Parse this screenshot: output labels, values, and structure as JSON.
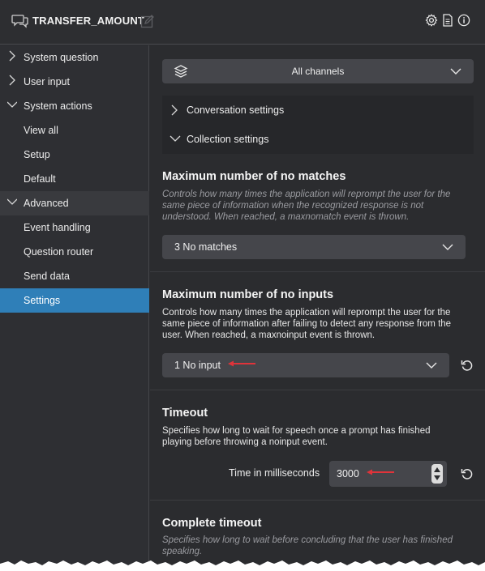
{
  "header": {
    "title": "TRANSFER_AMOUNT",
    "icons": [
      "chat-icon",
      "edit-icon",
      "gear-icon",
      "document-icon",
      "info-icon"
    ]
  },
  "sidebar": {
    "items": [
      {
        "label": "System question",
        "chevron": "right"
      },
      {
        "label": "User input",
        "chevron": "right"
      },
      {
        "label": "System actions",
        "chevron": "down"
      },
      {
        "label": "View all"
      },
      {
        "label": "Setup"
      },
      {
        "label": "Default"
      },
      {
        "label": "Advanced",
        "chevron": "down"
      },
      {
        "label": "Event handling"
      },
      {
        "label": "Question router"
      },
      {
        "label": "Send data"
      },
      {
        "label": "Settings",
        "active": true
      }
    ]
  },
  "main": {
    "channels_select": "All channels",
    "panels": [
      {
        "label": "Conversation settings",
        "chevron": "right"
      },
      {
        "label": "Collection settings",
        "chevron": "down"
      }
    ],
    "no_matches": {
      "title": "Maximum number of no matches",
      "description": "Controls how many times the application will reprompt the user for the same piece of information when the recognized response is not understood. When reached, a maxnomatch event is thrown.",
      "value": "3 No matches"
    },
    "no_inputs": {
      "title": "Maximum number of no inputs",
      "description": "Controls how many times the application will reprompt the user for the same piece of information after failing to detect any response from the user. When reached, a maxnoinput event is thrown.",
      "value": "1 No input"
    },
    "timeout": {
      "title": "Timeout",
      "description": "Specifies how long to wait for speech once a prompt has finished playing before throwing a noinput event.",
      "field_label": "Time in milliseconds",
      "value": "3000"
    },
    "complete_timeout": {
      "title": "Complete timeout",
      "description": "Specifies how long to wait before concluding that the user has finished speaking."
    }
  },
  "colors": {
    "background": "#2b2c2f",
    "active_item": "#2f7fb8",
    "control": "#45464b",
    "annotation_arrow": "#e0333a"
  }
}
